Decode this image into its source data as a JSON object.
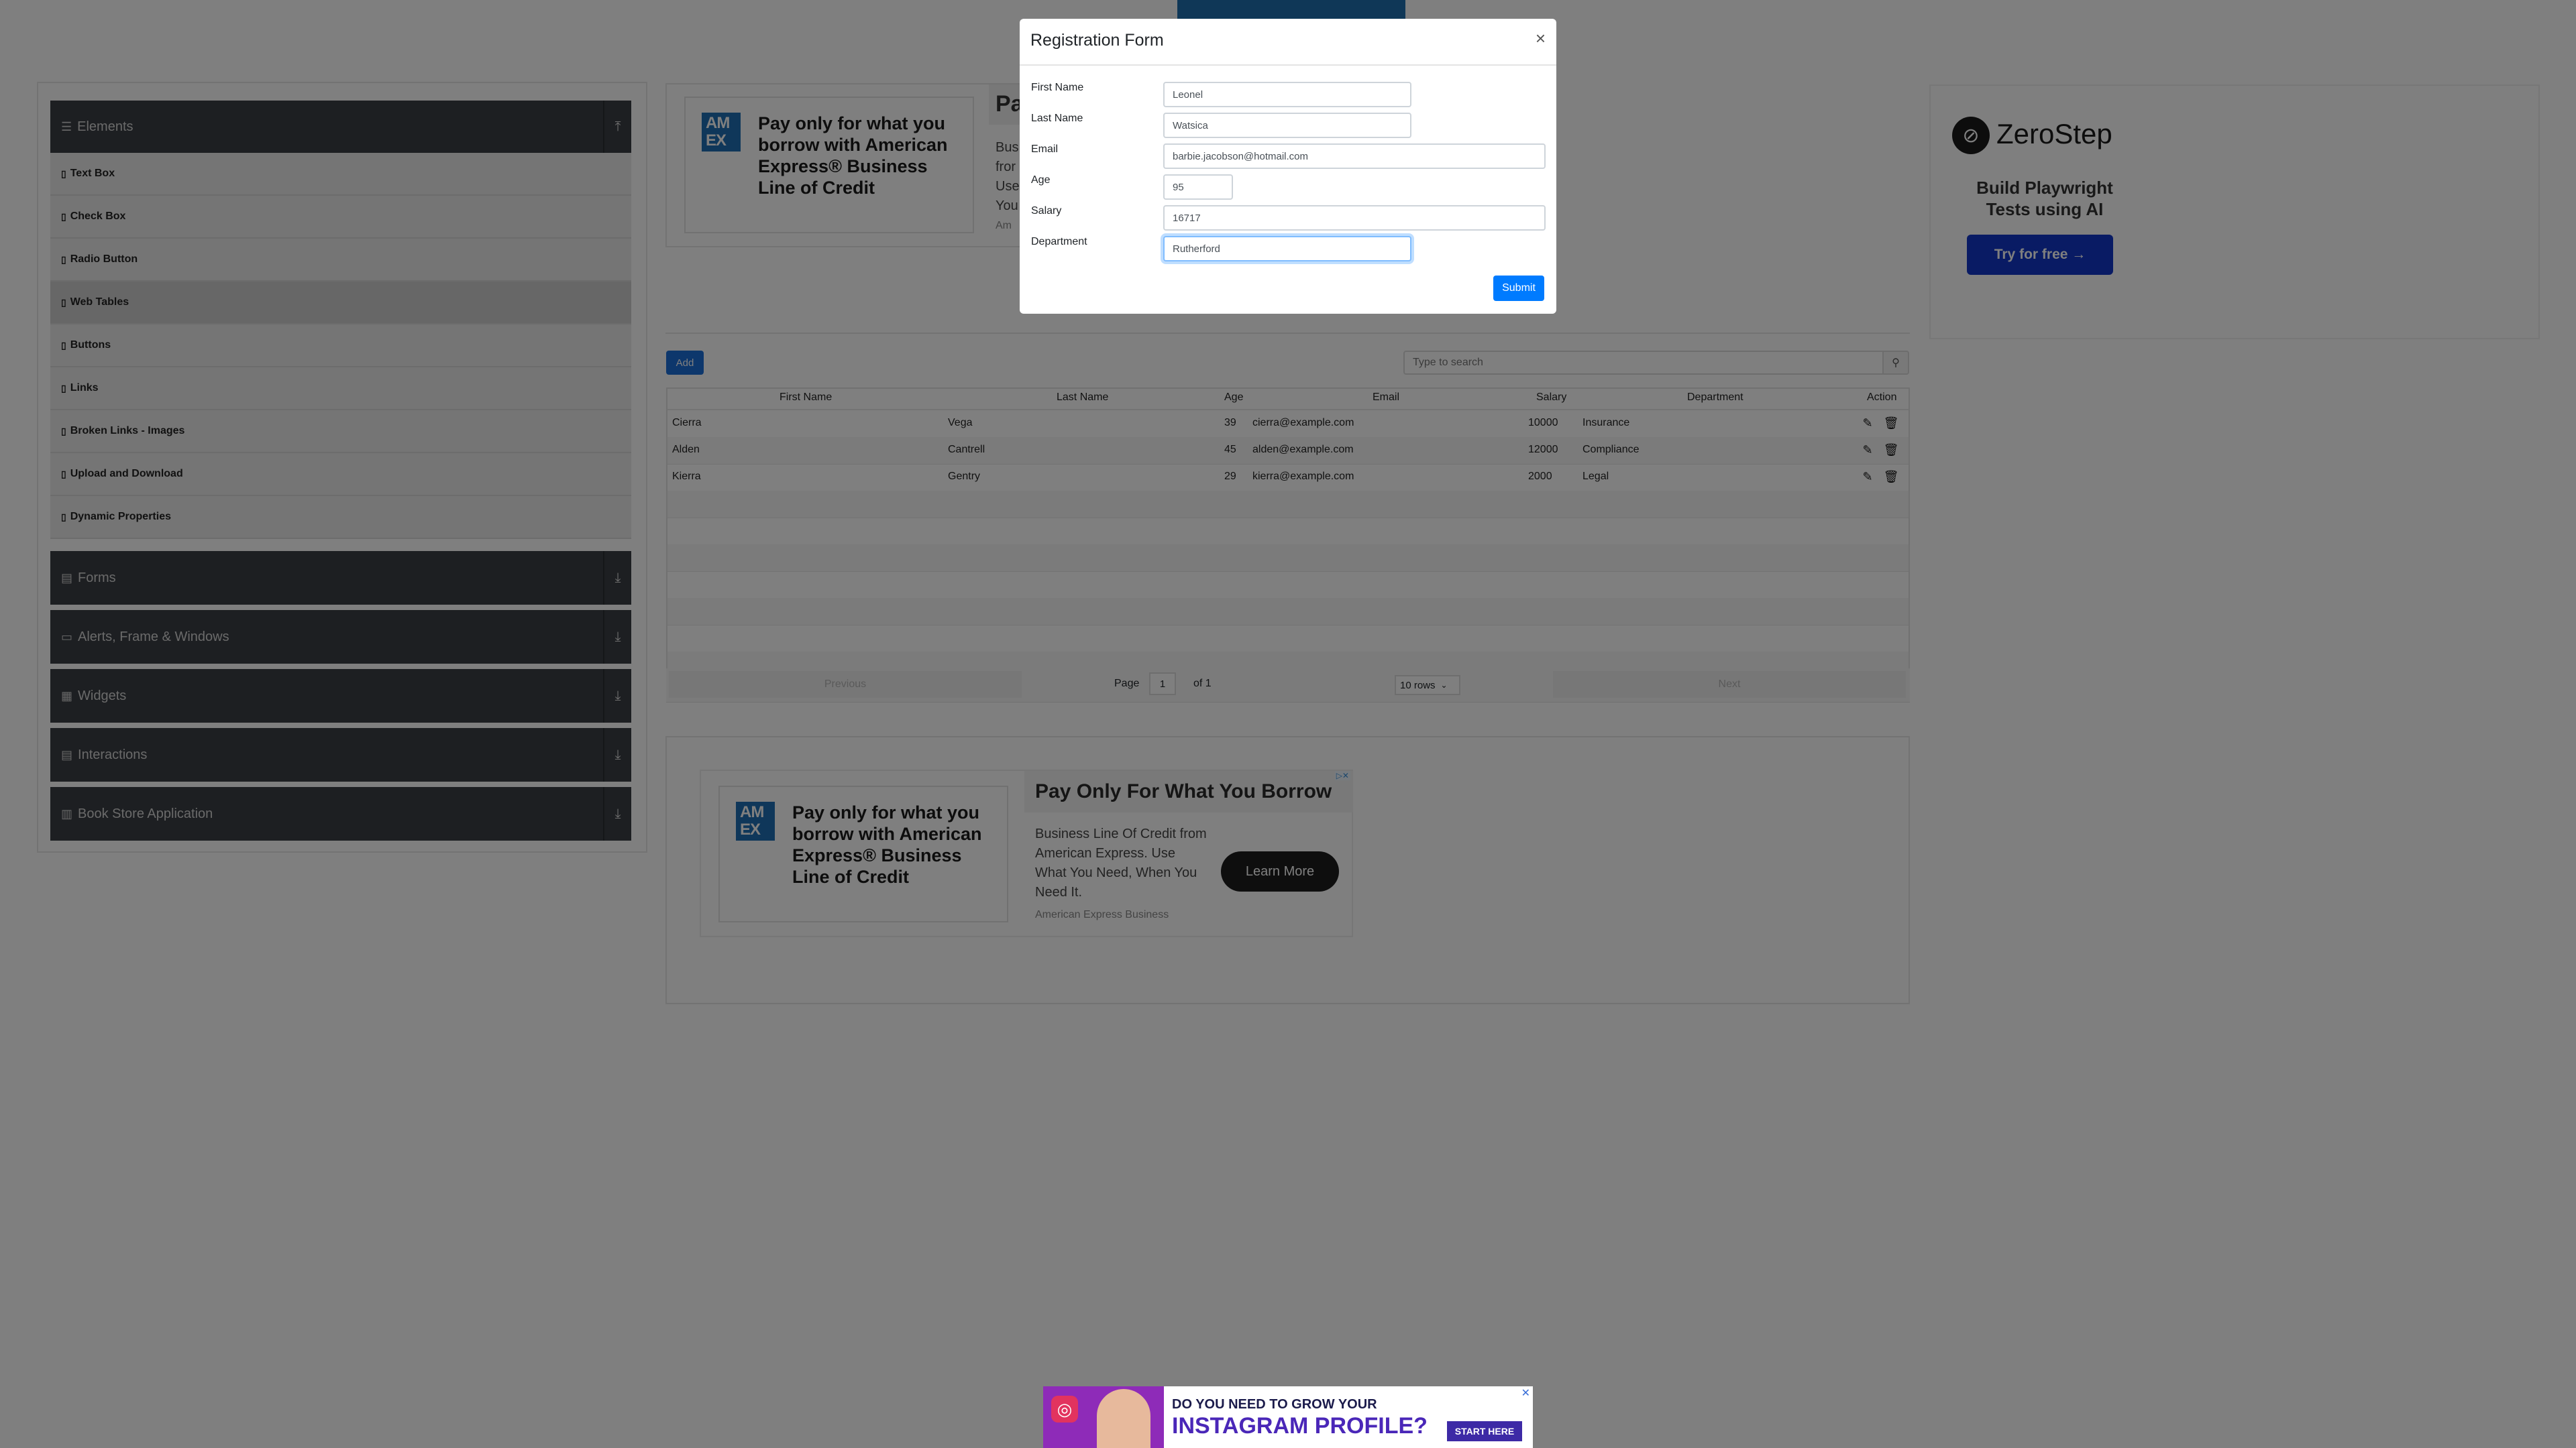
{
  "sidebar": {
    "groups": [
      {
        "label": "Elements",
        "icon": "list-icon"
      },
      {
        "label": "Forms",
        "icon": "form-icon"
      },
      {
        "label": "Alerts, Frame & Windows",
        "icon": "window-icon"
      },
      {
        "label": "Widgets",
        "icon": "grid-icon"
      },
      {
        "label": "Interactions",
        "icon": "hand-icon"
      },
      {
        "label": "Book Store Application",
        "icon": "book-icon"
      }
    ],
    "items": [
      "Text Box",
      "Check Box",
      "Radio Button",
      "Web Tables",
      "Buttons",
      "Links",
      "Broken Links - Images",
      "Upload and Download",
      "Dynamic Properties"
    ]
  },
  "ad_top": {
    "headline": "Pay only for what you borrow with American Express® Business Line of Credit",
    "logo": "AM EX",
    "partial_title": "Pa",
    "partial_body": [
      "Bus",
      "fror",
      "Use",
      "You",
      "Am"
    ]
  },
  "table": {
    "add_label": "Add",
    "search_placeholder": "Type to search",
    "headers": [
      "First Name",
      "Last Name",
      "Age",
      "Email",
      "Salary",
      "Department",
      "Action"
    ],
    "rows": [
      {
        "first": "Cierra",
        "last": "Vega",
        "age": "39",
        "email": "cierra@example.com",
        "salary": "10000",
        "dept": "Insurance"
      },
      {
        "first": "Alden",
        "last": "Cantrell",
        "age": "45",
        "email": "alden@example.com",
        "salary": "12000",
        "dept": "Compliance"
      },
      {
        "first": "Kierra",
        "last": "Gentry",
        "age": "29",
        "email": "kierra@example.com",
        "salary": "2000",
        "dept": "Legal"
      }
    ],
    "pagination": {
      "previous": "Previous",
      "page_label": "Page",
      "page": "1",
      "of_label": "of 1",
      "rows": "10 rows",
      "next": "Next"
    }
  },
  "ad_bottom": {
    "headline": "Pay only for what you borrow with American Express® Business Line of Credit",
    "logo": "AM EX",
    "title": "Pay Only For What You Borrow",
    "body": "Business Line Of Credit from American Express. Use What You Need, When You Need It.",
    "source": "American Express Business",
    "cta": "Learn More"
  },
  "zerostep": {
    "brand": "ZeroStep",
    "tagline": "Build Playwright Tests using AI",
    "cta": "Try for free →"
  },
  "modal": {
    "title": "Registration Form",
    "close": "×",
    "fields": [
      {
        "label": "First Name",
        "value": "Leonel"
      },
      {
        "label": "Last Name",
        "value": "Watsica"
      },
      {
        "label": "Email",
        "value": "barbie.jacobson@hotmail.com"
      },
      {
        "label": "Age",
        "value": "95"
      },
      {
        "label": "Salary",
        "value": "16717"
      },
      {
        "label": "Department",
        "value": "Rutherford"
      }
    ],
    "submit": "Submit"
  },
  "insta_ad": {
    "line1": "DO YOU NEED TO GROW YOUR",
    "line2": "INSTAGRAM PROFILE?",
    "cta": "START HERE"
  },
  "colors": {
    "primary": "#007bff",
    "sidebar": "#3b3f45",
    "zerostep": "#1236c9",
    "amex": "#1f6fb4"
  }
}
